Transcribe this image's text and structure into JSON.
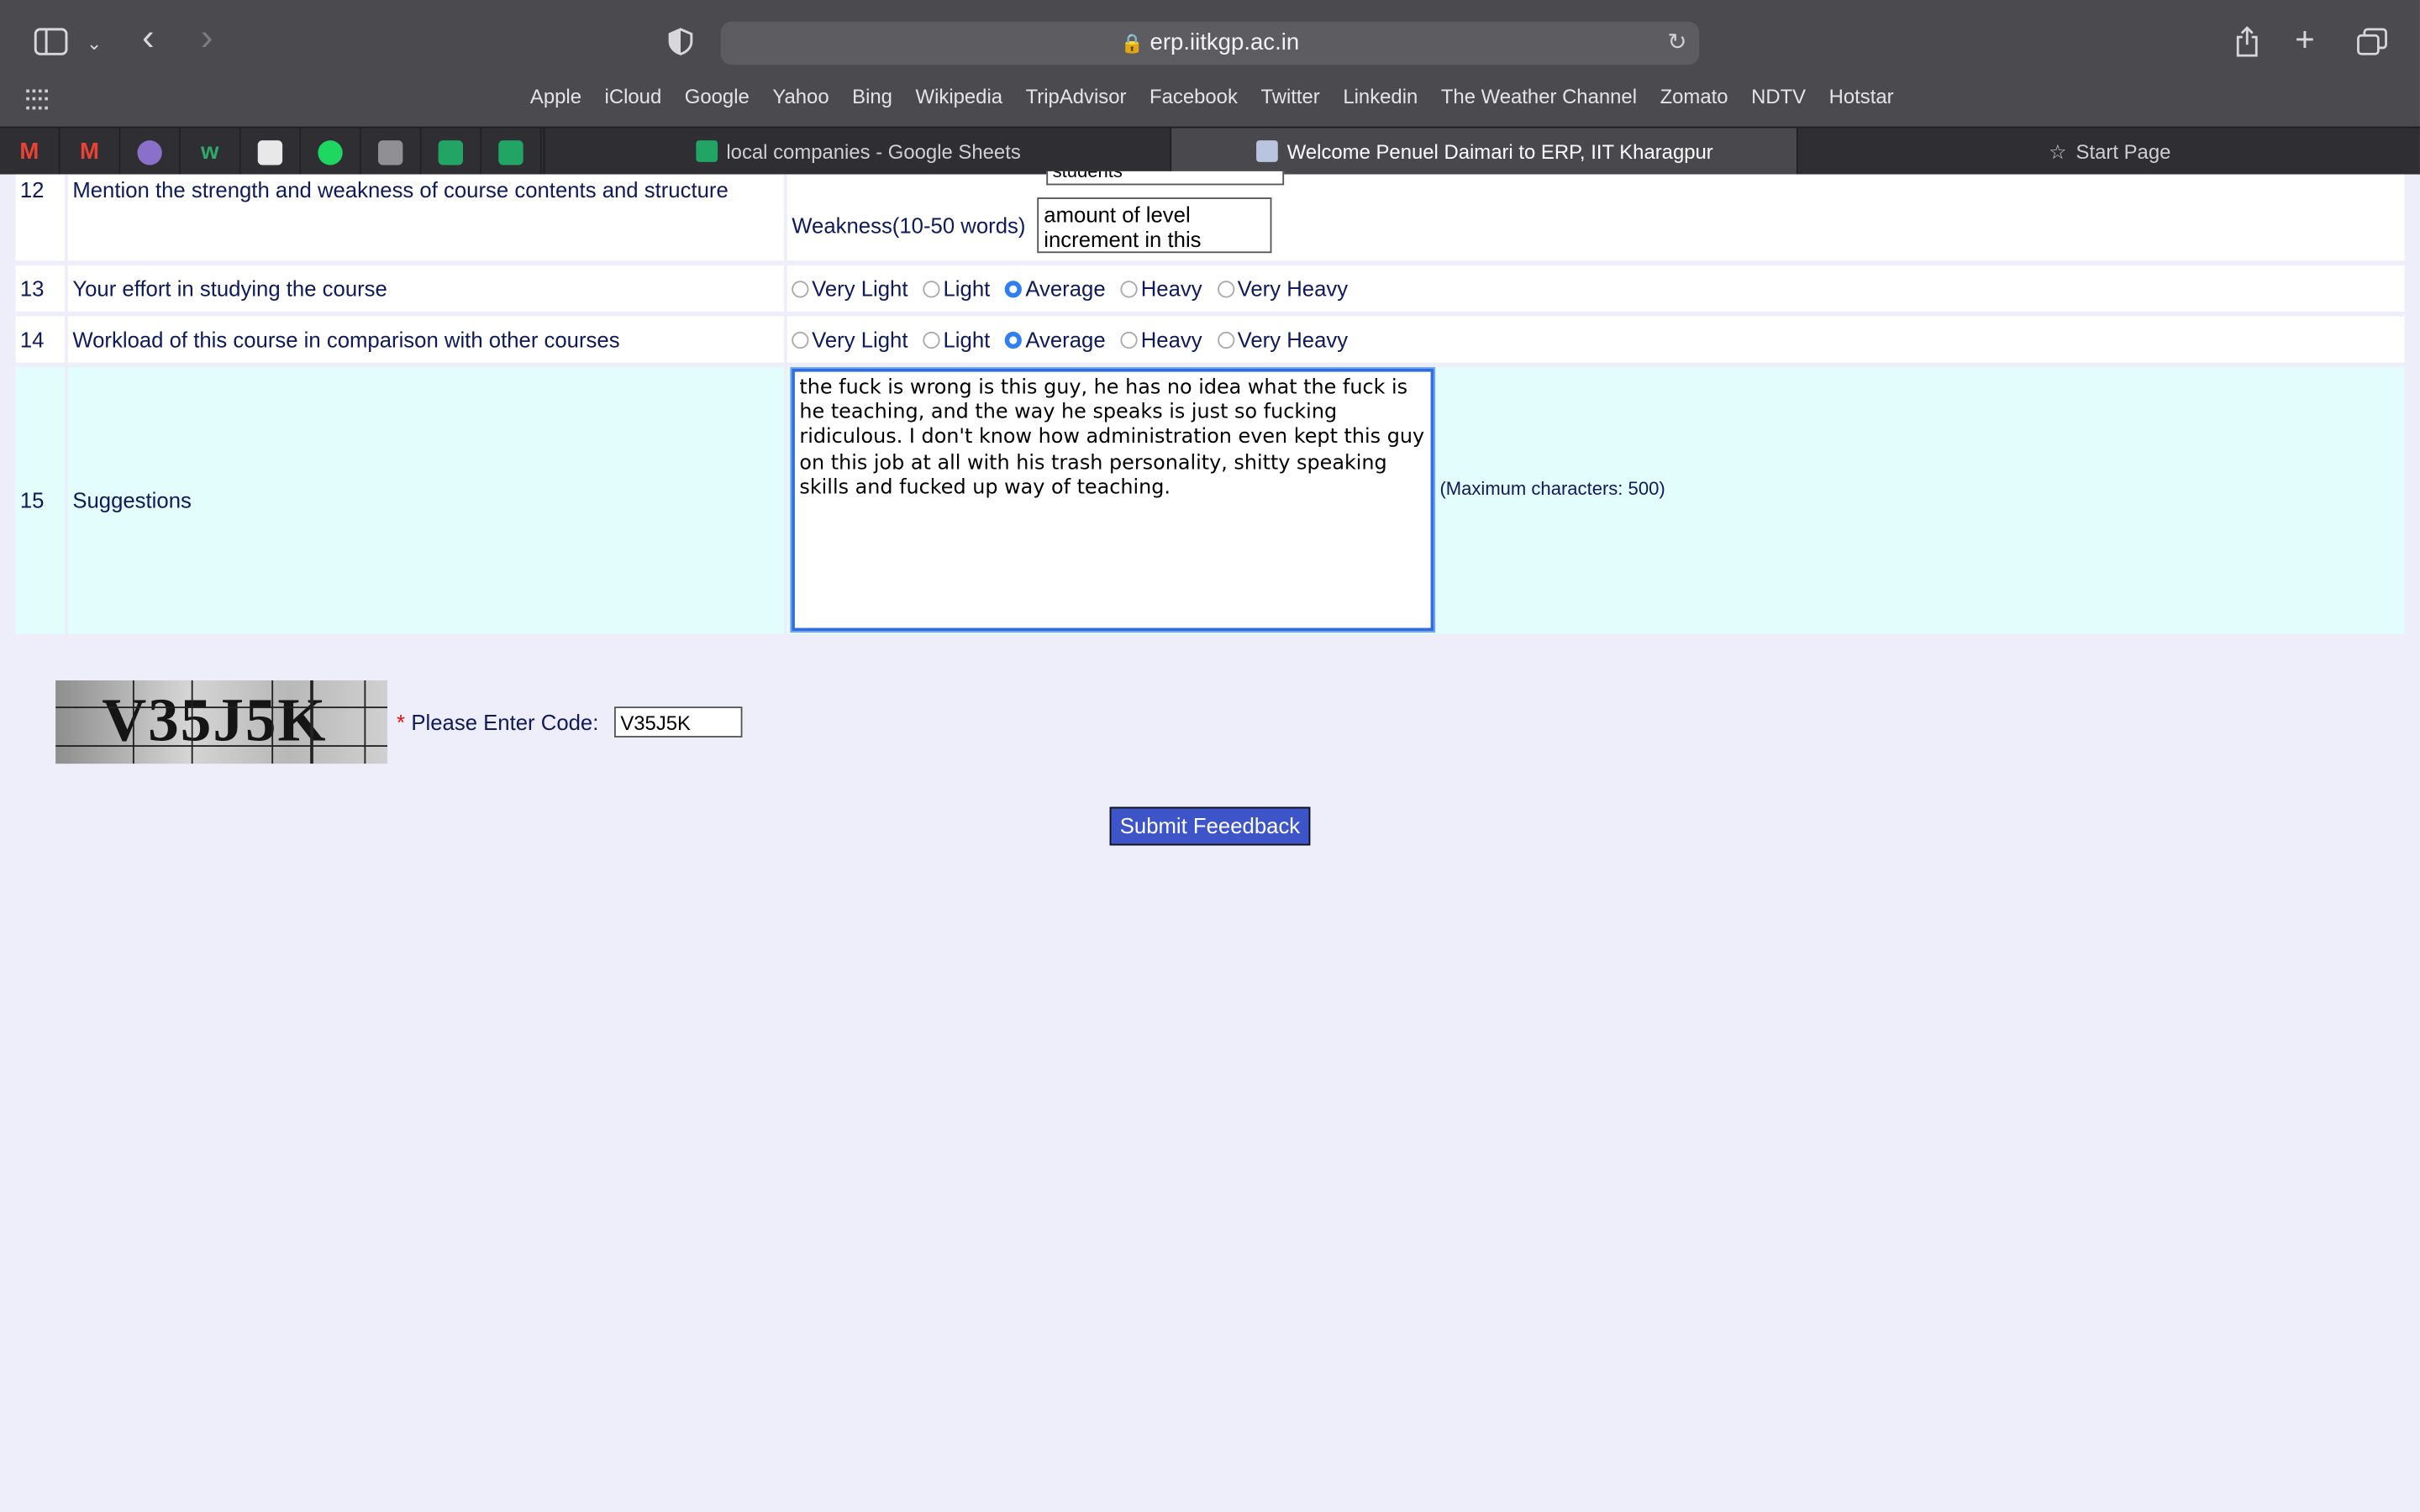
{
  "browser": {
    "url": "erp.iitkgp.ac.in",
    "favorites": [
      "Apple",
      "iCloud",
      "Google",
      "Yahoo",
      "Bing",
      "Wikipedia",
      "TripAdvisor",
      "Facebook",
      "Twitter",
      "Linkedin",
      "The Weather Channel",
      "Zomato",
      "NDTV",
      "Hotstar"
    ],
    "tabs": [
      {
        "label": "local companies - Google Sheets",
        "active": false
      },
      {
        "label": "Welcome Penuel Daimari to ERP, IIT Kharagpur",
        "active": true
      },
      {
        "label": "Start Page",
        "active": false
      }
    ]
  },
  "form": {
    "q12": {
      "num": "12",
      "text": "Mention the strength and weakness of course contents and structure",
      "weakness_label": "Weakness(10-50 words)",
      "strength_tail": "students",
      "weakness_value": "amount of level increment in this"
    },
    "q13": {
      "num": "13",
      "text": "Your effort in studying the course",
      "selected": "Average"
    },
    "q14": {
      "num": "14",
      "text": "Workload of this course in comparison with other courses",
      "selected": "Average"
    },
    "options": [
      "Very Light",
      "Light",
      "Average",
      "Heavy",
      "Very Heavy"
    ],
    "q15": {
      "num": "15",
      "text": "Suggestions",
      "value": "the fuck is wrong is this guy, he has no idea what the fuck is he teaching, and the way he speaks is just so fucking ridiculous. I don't know how administration even kept this guy on this job at all with his trash personality, shitty speaking skills and fucked up way of teaching.",
      "max_chars": "(Maximum characters: 500)"
    },
    "captcha": {
      "image_text": "V35J5K",
      "required_marker": "*",
      "label": "Please Enter Code:",
      "value": "V35J5K"
    },
    "submit_label": "Submit Feeedback"
  }
}
